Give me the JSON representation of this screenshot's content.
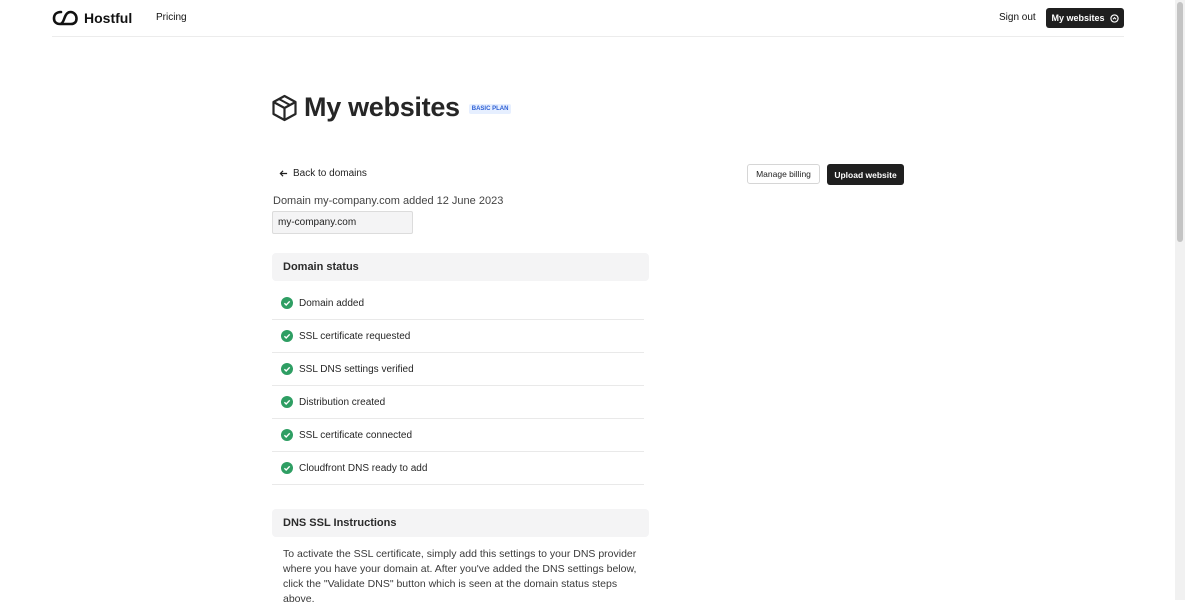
{
  "header": {
    "brand": "Hostful",
    "nav_pricing": "Pricing",
    "sign_out": "Sign out",
    "my_websites_button": "My websites"
  },
  "page": {
    "title": "My websites",
    "plan_badge": "BASIC PLAN",
    "back_link": "Back to domains",
    "manage_billing": "Manage billing",
    "upload_website": "Upload website",
    "domain_info": "Domain my-company.com added 12 June 2023",
    "domain_input_value": "my-company.com"
  },
  "domain_status": {
    "heading": "Domain status",
    "items": [
      {
        "label": "Domain added",
        "done": true
      },
      {
        "label": "SSL certificate requested",
        "done": true
      },
      {
        "label": "SSL DNS settings verified",
        "done": true
      },
      {
        "label": "Distribution created",
        "done": true
      },
      {
        "label": "SSL certificate connected",
        "done": true
      },
      {
        "label": "Cloudfront DNS ready to add",
        "done": true
      }
    ]
  },
  "dns_instructions": {
    "heading": "DNS SSL Instructions",
    "text": "To activate the SSL certificate, simply add this settings to your DNS provider where you have your domain at. After you've added the DNS settings below, click the \"Validate DNS\" button which is seen at the domain status steps above."
  },
  "colors": {
    "accent_dark": "#1f1f1f",
    "check_green": "#2e9e63",
    "badge_blue": "#2d5fd4"
  },
  "icons": {
    "logo": "infinity-cloud-logo",
    "title": "cube-icon",
    "back": "arrow-left-icon",
    "my_websites": "circle-arrow-icon",
    "status": "check-circle-icon"
  }
}
